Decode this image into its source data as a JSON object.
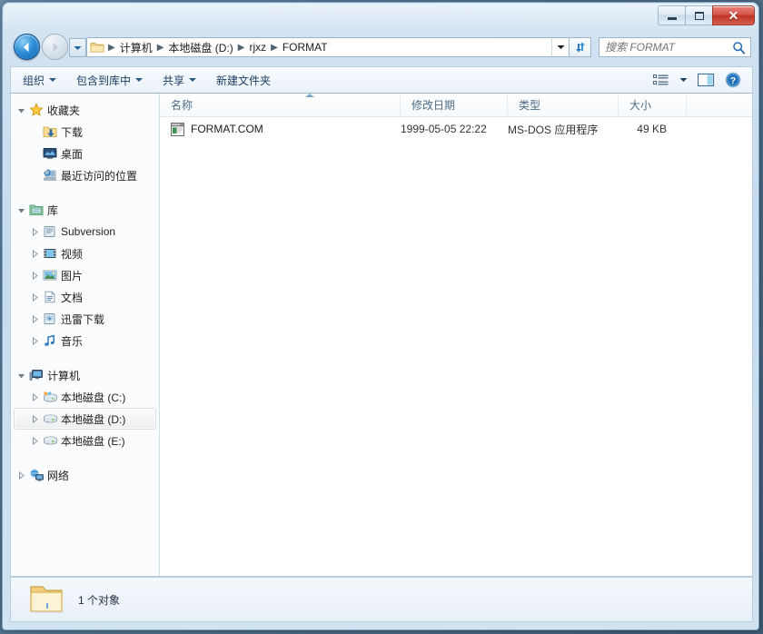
{
  "window": {
    "caption_buttons": {
      "minimize": "最小化",
      "maximize": "最大化",
      "close": "关闭"
    }
  },
  "navigation": {
    "back_label": "后退",
    "forward_label": "前进",
    "recent_pages_label": "最近浏览的页面",
    "refresh_label": "刷新",
    "address_dropdown_label": "历史记录"
  },
  "address": {
    "folder_icon": "folder-icon",
    "separator": "▶",
    "crumbs": [
      "计算机",
      "本地磁盘 (D:)",
      "rjxz",
      "FORMAT"
    ]
  },
  "search": {
    "placeholder": "搜索 FORMAT",
    "icon": "search-icon"
  },
  "toolbar": {
    "items": [
      {
        "label": "组织",
        "has_caret": true
      },
      {
        "label": "包含到库中",
        "has_caret": true
      },
      {
        "label": "共享",
        "has_caret": true
      },
      {
        "label": "新建文件夹",
        "has_caret": false
      }
    ],
    "view_options_label": "更改您的视图",
    "preview_pane_label": "显示预览窗格",
    "help_label": "获取帮助"
  },
  "sidebar": {
    "groups": [
      {
        "name": "收藏夹",
        "icon": "star-icon",
        "expanded": true,
        "items": [
          {
            "label": "下载",
            "icon": "downloads-icon",
            "expander": false
          },
          {
            "label": "桌面",
            "icon": "desktop-icon",
            "expander": false
          },
          {
            "label": "最近访问的位置",
            "icon": "recent-places-icon",
            "expander": false
          }
        ]
      },
      {
        "name": "库",
        "icon": "library-icon",
        "expanded": true,
        "items": [
          {
            "label": "Subversion",
            "icon": "library-folder-icon",
            "expander": true
          },
          {
            "label": "视频",
            "icon": "video-icon",
            "expander": true
          },
          {
            "label": "图片",
            "icon": "pictures-icon",
            "expander": true
          },
          {
            "label": "文档",
            "icon": "documents-icon",
            "expander": true
          },
          {
            "label": "迅雷下载",
            "icon": "thunder-download-icon",
            "expander": true
          },
          {
            "label": "音乐",
            "icon": "music-icon",
            "expander": true
          }
        ]
      },
      {
        "name": "计算机",
        "icon": "computer-icon",
        "expanded": true,
        "items": [
          {
            "label": "本地磁盘 (C:)",
            "icon": "system-drive-icon",
            "expander": true,
            "selected": false
          },
          {
            "label": "本地磁盘 (D:)",
            "icon": "drive-icon",
            "expander": true,
            "selected": true
          },
          {
            "label": "本地磁盘 (E:)",
            "icon": "drive-icon",
            "expander": true,
            "selected": false
          }
        ]
      },
      {
        "name": "网络",
        "icon": "network-icon",
        "expanded": false,
        "items": []
      }
    ]
  },
  "filelist": {
    "columns": [
      {
        "label": "名称",
        "sorted": "asc"
      },
      {
        "label": "修改日期",
        "sorted": ""
      },
      {
        "label": "类型",
        "sorted": ""
      },
      {
        "label": "大小",
        "sorted": ""
      }
    ],
    "rows": [
      {
        "name": "FORMAT.COM",
        "date": "1999-05-05 22:22",
        "type": "MS-DOS 应用程序",
        "size": "49 KB",
        "icon": "msdos-application-icon"
      }
    ]
  },
  "statusbar": {
    "icon": "folder-icon",
    "text": "1 个对象"
  },
  "colors": {
    "frame": "#c8deef",
    "close_button": "#bf3327",
    "accent_blue": "#1766ad",
    "header_text": "#4a6b85",
    "selection": "#eceef0"
  }
}
